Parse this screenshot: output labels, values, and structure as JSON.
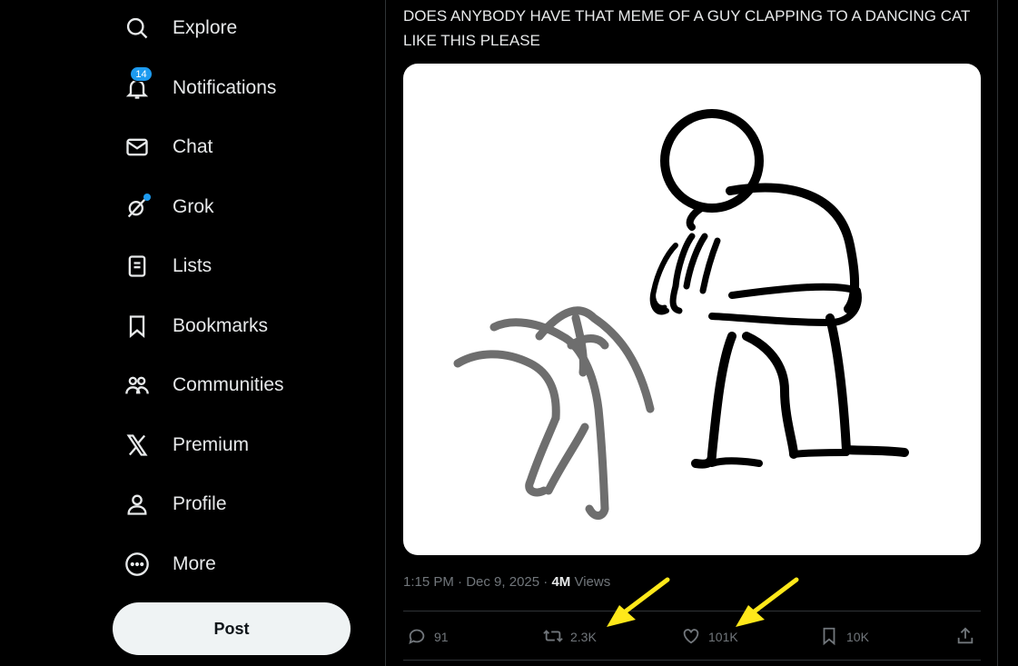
{
  "sidebar": {
    "items": [
      {
        "label": "Explore",
        "icon": "search-icon"
      },
      {
        "label": "Notifications",
        "icon": "bell-icon",
        "badge": "14"
      },
      {
        "label": "Chat",
        "icon": "mail-icon"
      },
      {
        "label": "Grok",
        "icon": "grok-icon"
      },
      {
        "label": "Lists",
        "icon": "list-icon"
      },
      {
        "label": "Bookmarks",
        "icon": "bookmark-icon"
      },
      {
        "label": "Communities",
        "icon": "communities-icon"
      },
      {
        "label": "Premium",
        "icon": "x-logo-icon"
      },
      {
        "label": "Profile",
        "icon": "person-icon"
      },
      {
        "label": "More",
        "icon": "more-circle-icon"
      }
    ],
    "post_label": "Post"
  },
  "tweet": {
    "text": "DOES ANYBODY HAVE THAT MEME OF A GUY CLAPPING TO A DANCING CAT LIKE THIS PLEASE",
    "time": "1:15 PM",
    "date": "Dec 9, 2025",
    "views_count": "4M",
    "views_label": "Views",
    "actions": {
      "replies": "91",
      "reposts": "2.3K",
      "likes": "101K",
      "bookmarks": "10K"
    }
  },
  "colors": {
    "background": "#000000",
    "accent": "#1d9bf0",
    "annotation_arrow": "#ffe81a",
    "muted_text": "#71767b"
  }
}
